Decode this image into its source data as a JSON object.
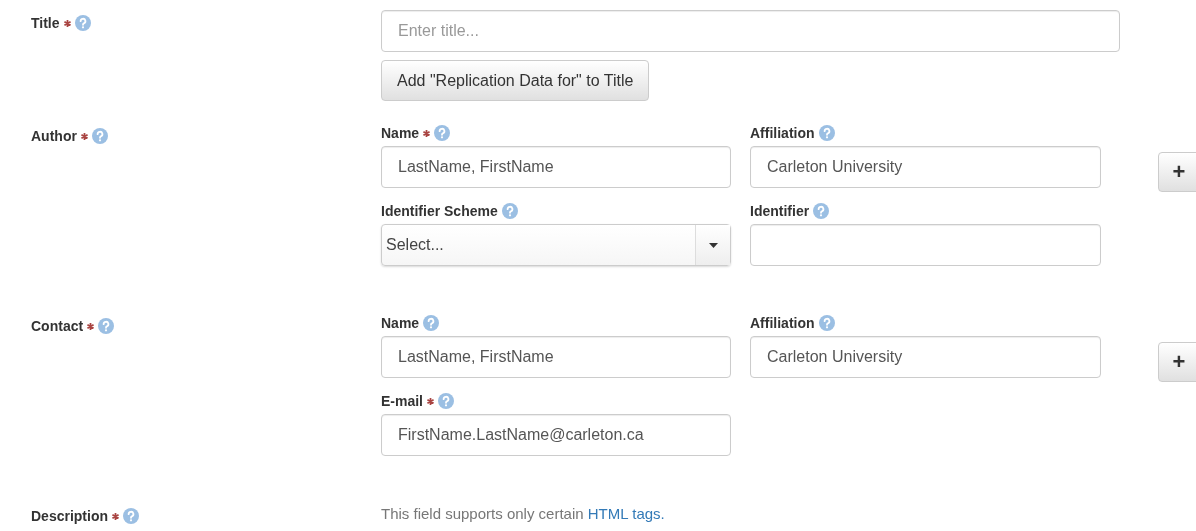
{
  "fields": [
    {
      "label": "Title",
      "required": true,
      "kind": "title",
      "placeholder": "Enter title...",
      "button": "Add \"Replication Data for\" to Title"
    },
    {
      "label": "Author",
      "required": true,
      "kind": "compound",
      "add_button": "+",
      "subfields": [
        {
          "label": "Name",
          "required": true,
          "kind": "text",
          "value": "LastName, FirstName"
        },
        {
          "label": "Affiliation",
          "required": false,
          "kind": "text",
          "value": "Carleton University"
        },
        {
          "label": "Identifier Scheme",
          "required": false,
          "kind": "select",
          "value": "Select..."
        },
        {
          "label": "Identifier",
          "required": false,
          "kind": "text"
        }
      ]
    },
    {
      "label": "Contact",
      "required": true,
      "kind": "compound",
      "add_button": "+",
      "subfields": [
        {
          "label": "Name",
          "required": false,
          "kind": "text",
          "value": "LastName, FirstName"
        },
        {
          "label": "Affiliation",
          "required": false,
          "kind": "text",
          "value": "Carleton University"
        },
        {
          "label": "E-mail",
          "required": true,
          "kind": "text",
          "value": "FirstName.LastName@carleton.ca"
        }
      ]
    },
    {
      "label": "Description",
      "required": true,
      "kind": "note",
      "note": "This field supports only certain ",
      "link": "HTML tags."
    }
  ]
}
